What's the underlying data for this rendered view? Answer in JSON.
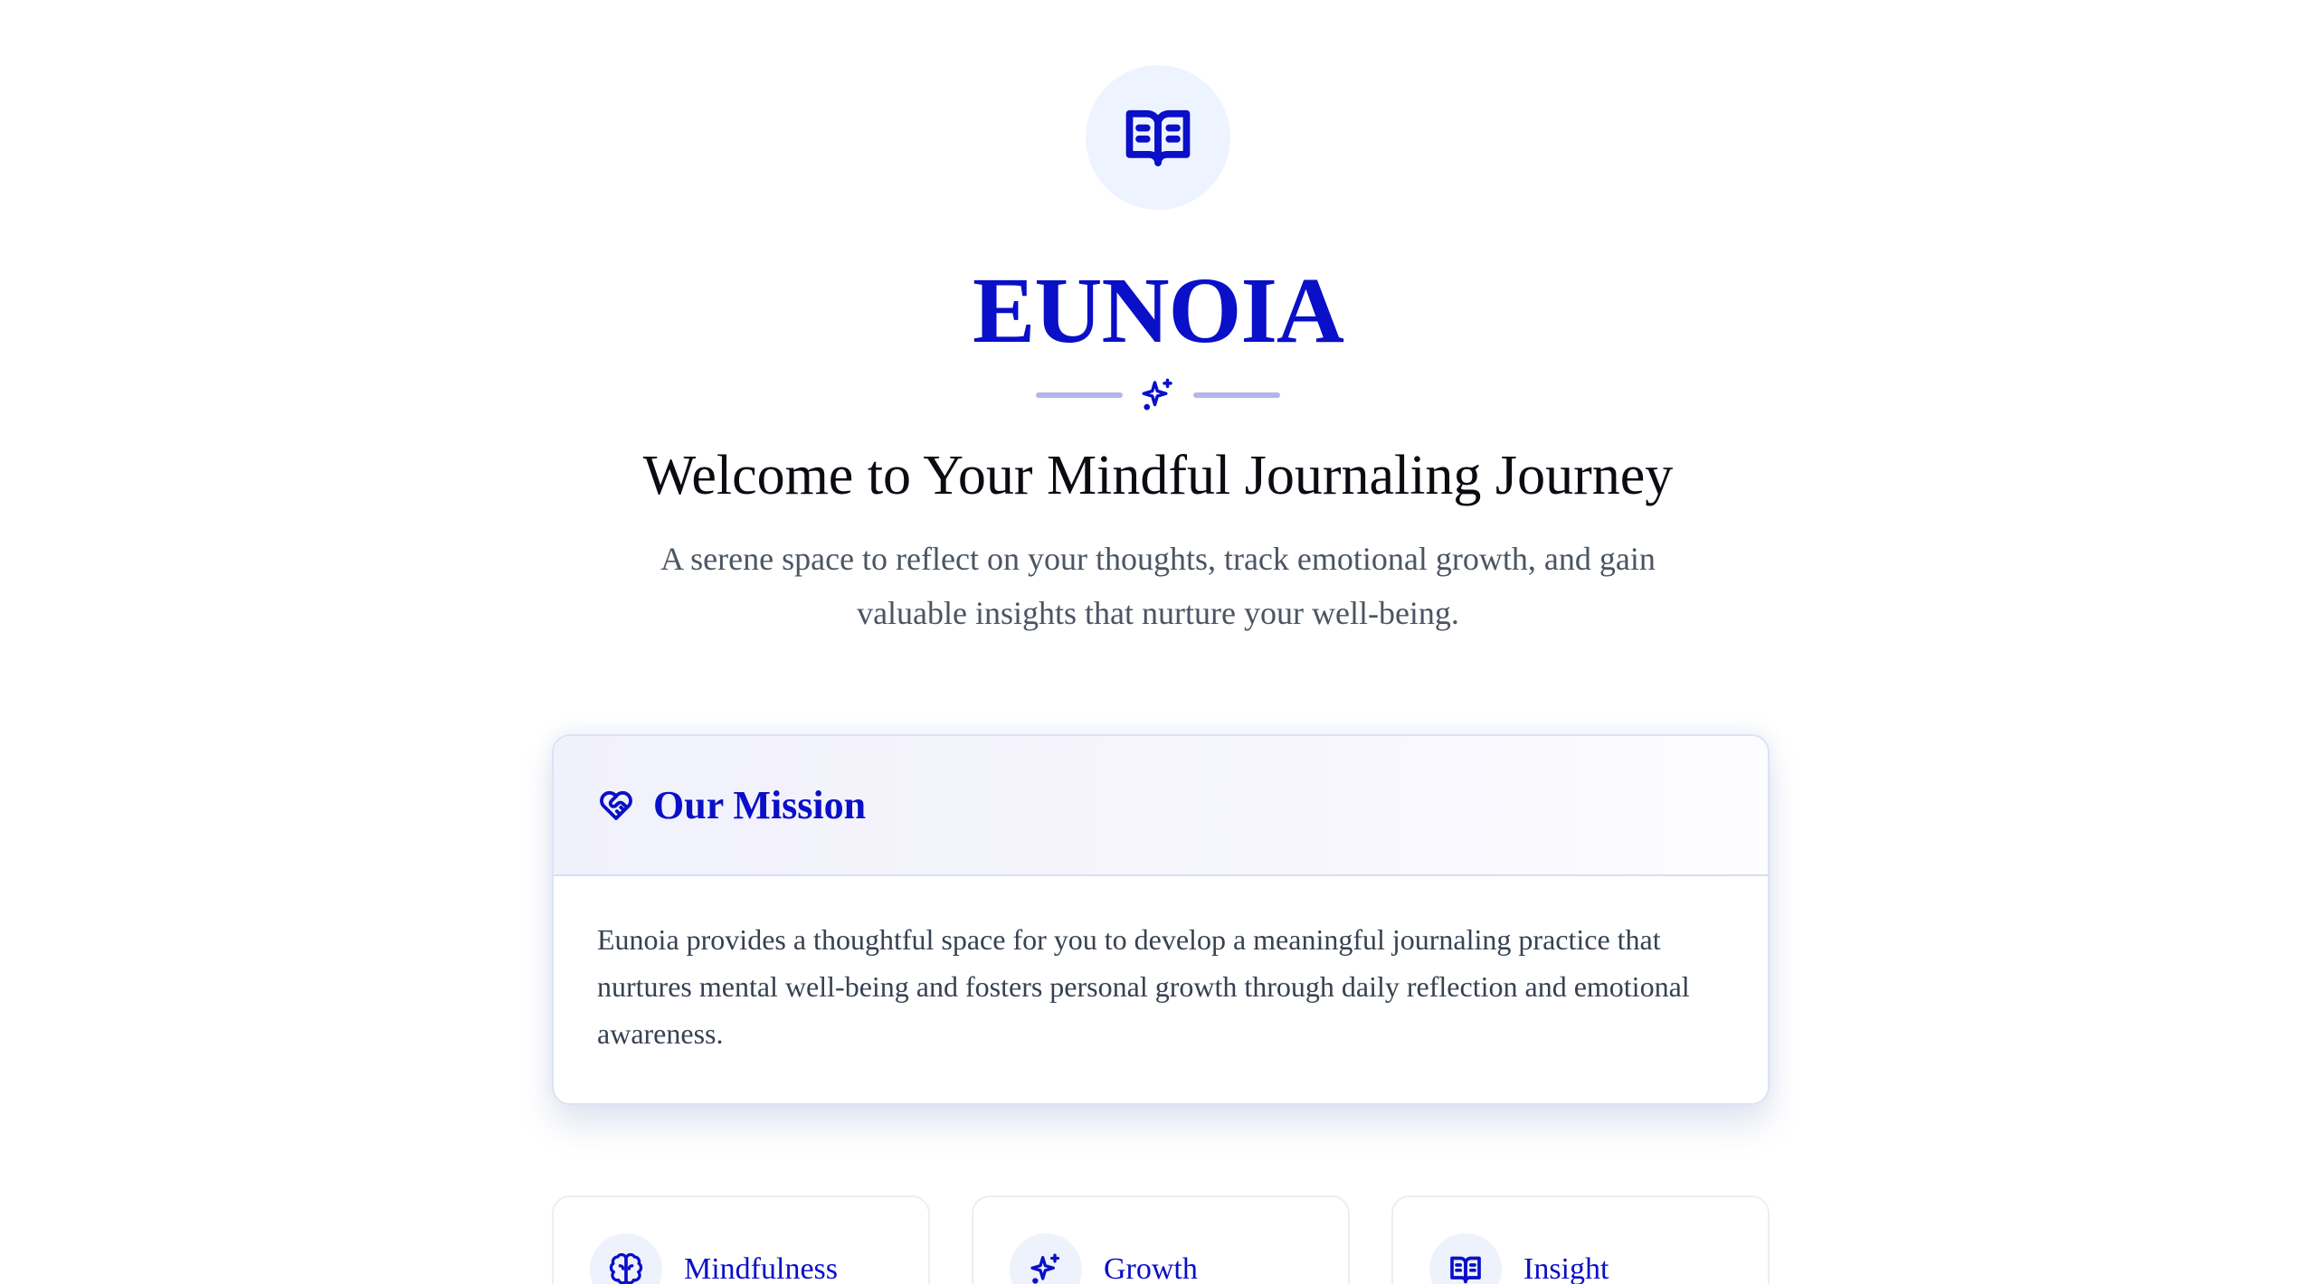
{
  "hero": {
    "icon": "open-book-icon",
    "brand": "EUNOIA",
    "divider_icon": "sparkles-icon",
    "welcome": "Welcome to Your Mindful Journaling Journey",
    "subtitle": "A serene space to reflect on your thoughts, track emotional growth, and gain valuable insights that nurture your well-being."
  },
  "mission": {
    "icon": "heart-handshake-icon",
    "title": "Our Mission",
    "body": "Eunoia provides a thoughtful space for you to develop a meaningful journaling practice that nurtures mental well-being and fosters personal growth through daily reflection and emotional awareness."
  },
  "features": [
    {
      "icon": "brain-icon",
      "label": "Mindfulness"
    },
    {
      "icon": "sparkles-icon",
      "label": "Growth"
    },
    {
      "icon": "open-book-icon",
      "label": "Insight"
    }
  ],
  "colors": {
    "brand": "#0a0fc8",
    "icon_bg": "#eef4ff",
    "divider": "#b3b6ea",
    "muted_text": "#4b5563"
  }
}
